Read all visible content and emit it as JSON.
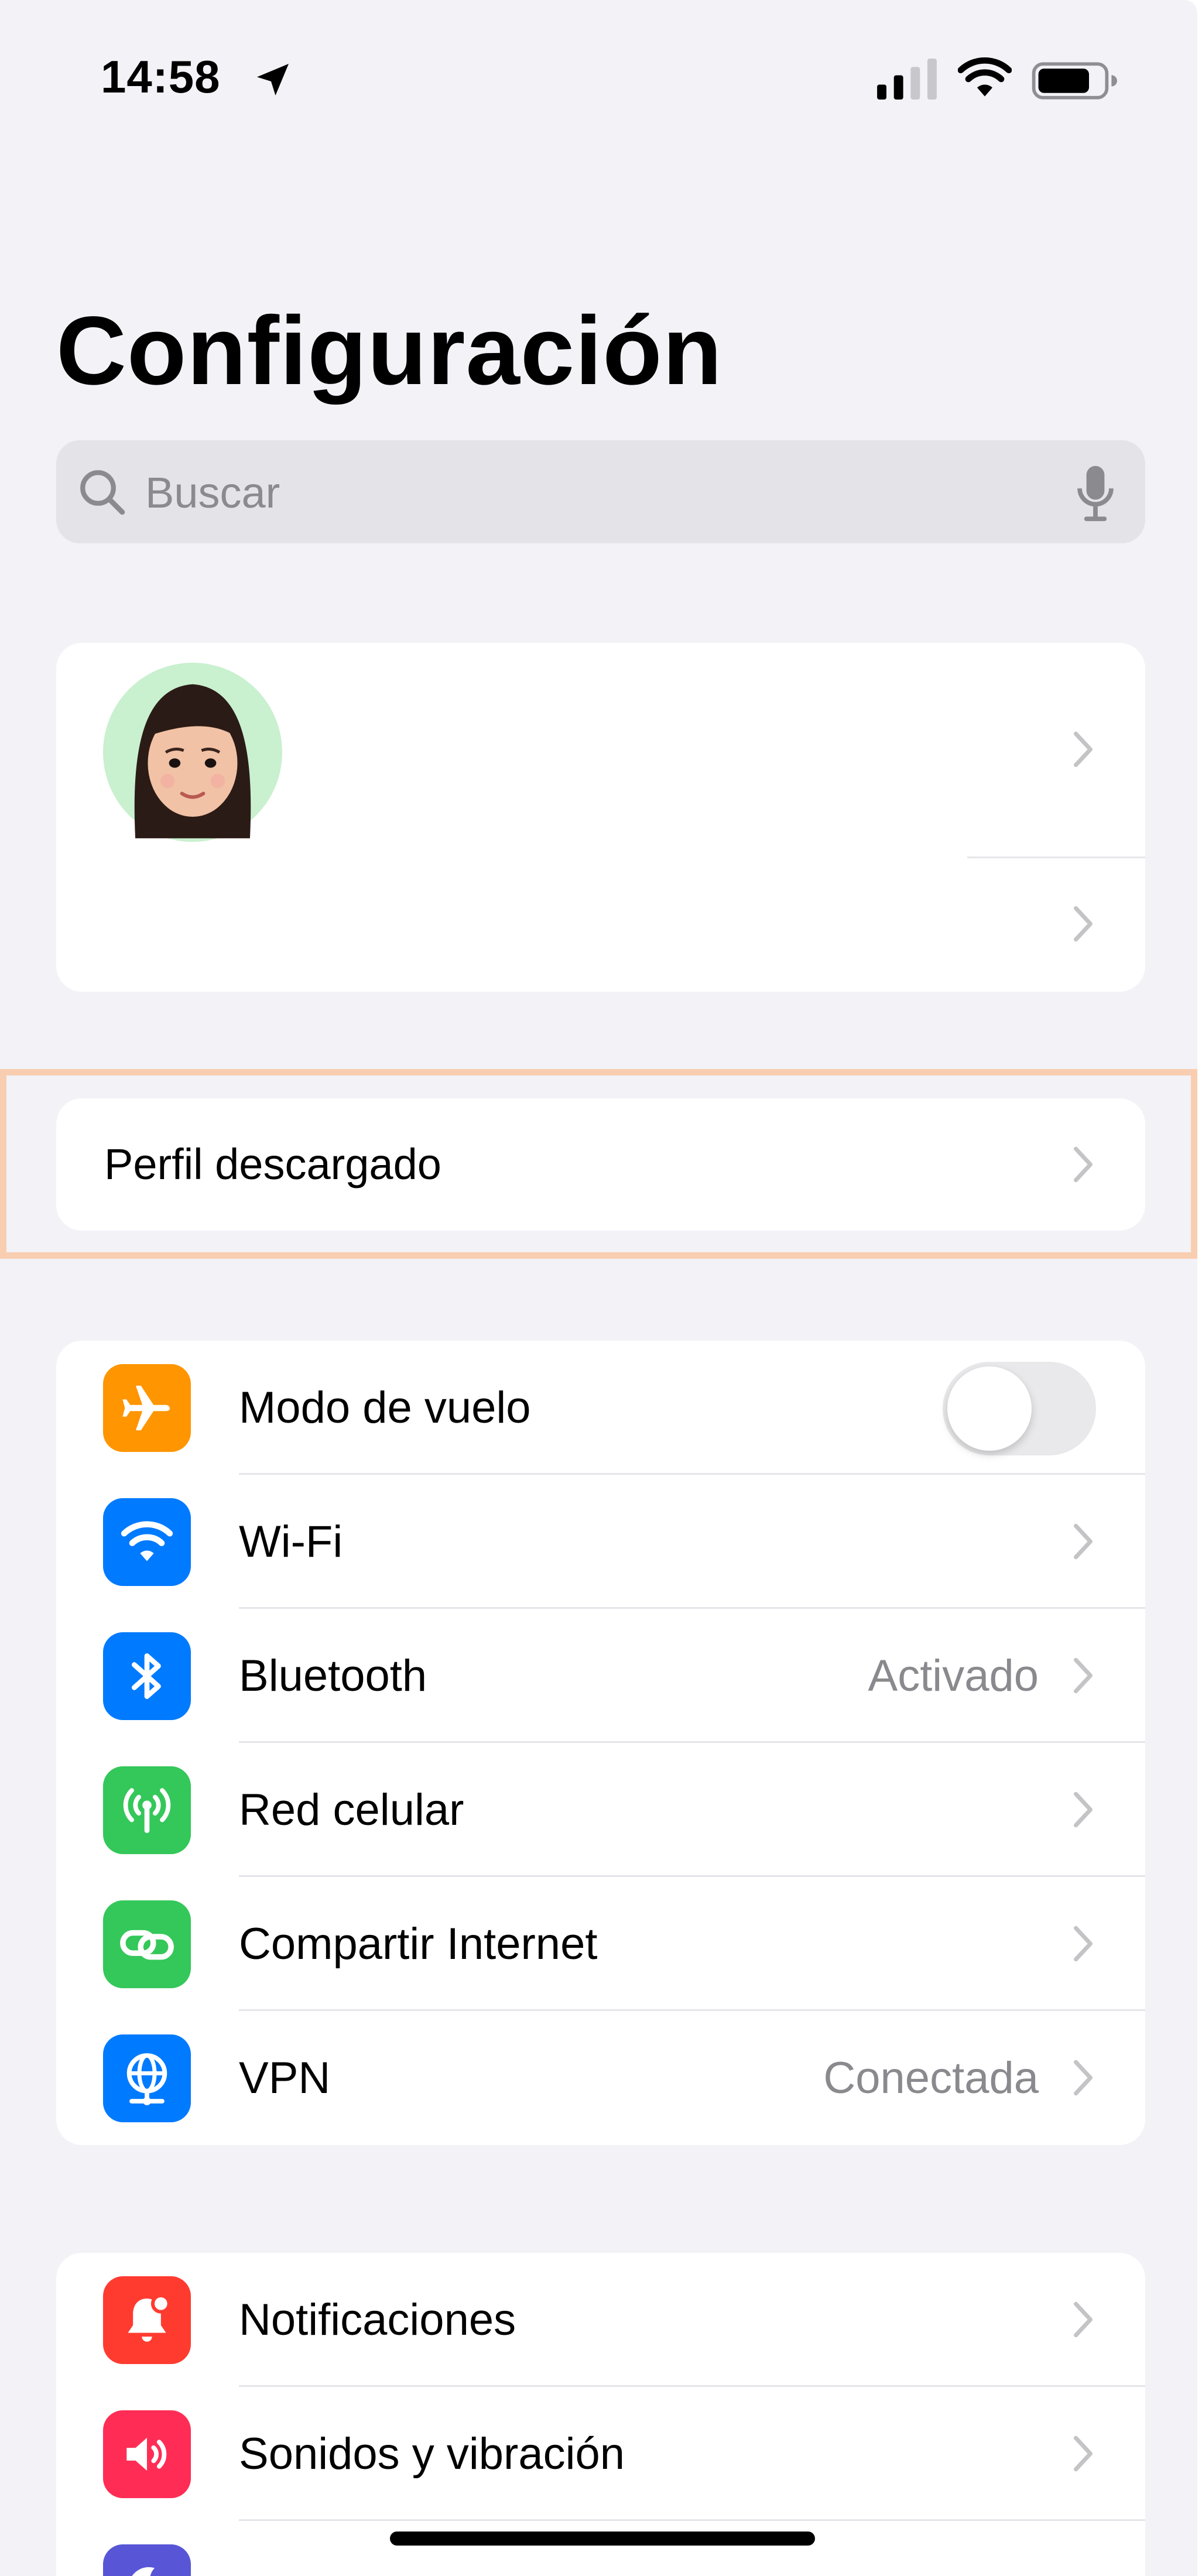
{
  "status_bar": {
    "time": "14:58"
  },
  "title": "Configuración",
  "search": {
    "placeholder": "Buscar"
  },
  "profile_row": {
    "label": "Perfil descargado"
  },
  "connectivity": [
    {
      "id": "airplane",
      "label": "Modo de vuelo",
      "value": "",
      "icon": "airplane-icon",
      "color": "#ff9500",
      "toggle_on": false
    },
    {
      "id": "wifi",
      "label": "Wi-Fi",
      "value": "",
      "icon": "wifi-icon",
      "color": "#007aff"
    },
    {
      "id": "bluetooth",
      "label": "Bluetooth",
      "value": "Activado",
      "icon": "bluetooth-icon",
      "color": "#007aff"
    },
    {
      "id": "cellular",
      "label": "Red celular",
      "value": "",
      "icon": "antenna-icon",
      "color": "#34c759"
    },
    {
      "id": "hotspot",
      "label": "Compartir Internet",
      "value": "",
      "icon": "link-icon",
      "color": "#34c759"
    },
    {
      "id": "vpn",
      "label": "VPN",
      "value": "Conectada",
      "icon": "globe-icon",
      "color": "#007aff"
    }
  ],
  "notifications_group": [
    {
      "id": "notifications",
      "label": "Notificaciones",
      "icon": "bell-icon",
      "color": "#ff3b30"
    },
    {
      "id": "sounds",
      "label": "Sonidos y vibración",
      "icon": "speaker-icon",
      "color": "#ff2d55"
    }
  ],
  "colors": {
    "background": "#f2f2f7",
    "highlight_border": "#f9cdb0",
    "toggle_off": "#e9e9eb"
  }
}
